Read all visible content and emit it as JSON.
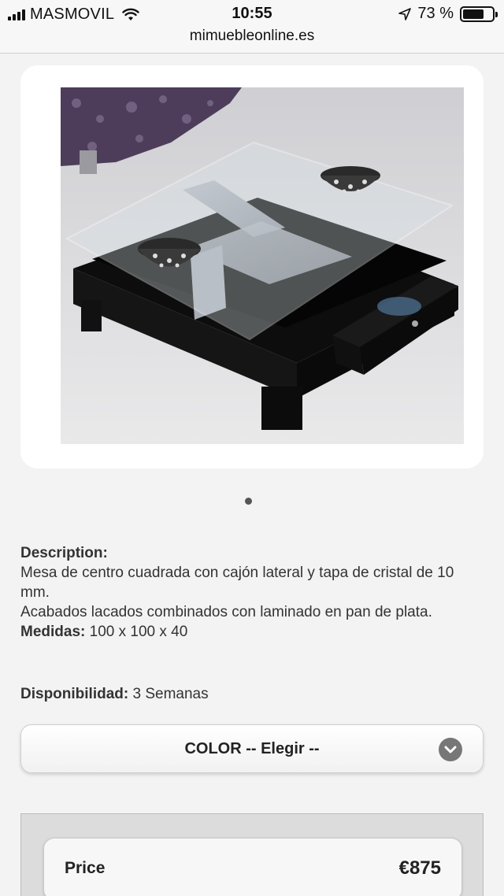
{
  "status_bar": {
    "carrier": "MASMOVIL",
    "time": "10:55",
    "battery_percent": "73 %",
    "battery_level": 0.73
  },
  "browser": {
    "url": "mimuebleonline.es"
  },
  "gallery": {
    "image_icon": "product-photo-coffee-table",
    "page_count": 1,
    "active_page": 1
  },
  "description": {
    "heading": "Description:",
    "line1": "Mesa de centro cuadrada con cajón lateral y tapa de cristal de 10 mm.",
    "line2": "Acabados lacados combinados con laminado en pan de plata.",
    "medidas_label": "Medidas:",
    "medidas_value": "100 x 100 x 40"
  },
  "availability": {
    "label": "Disponibilidad:",
    "value": "3 Semanas"
  },
  "color_select": {
    "label": "COLOR -- Elegir --",
    "icon": "chevron-down-icon"
  },
  "price": {
    "label": "Price",
    "value": "€875"
  }
}
